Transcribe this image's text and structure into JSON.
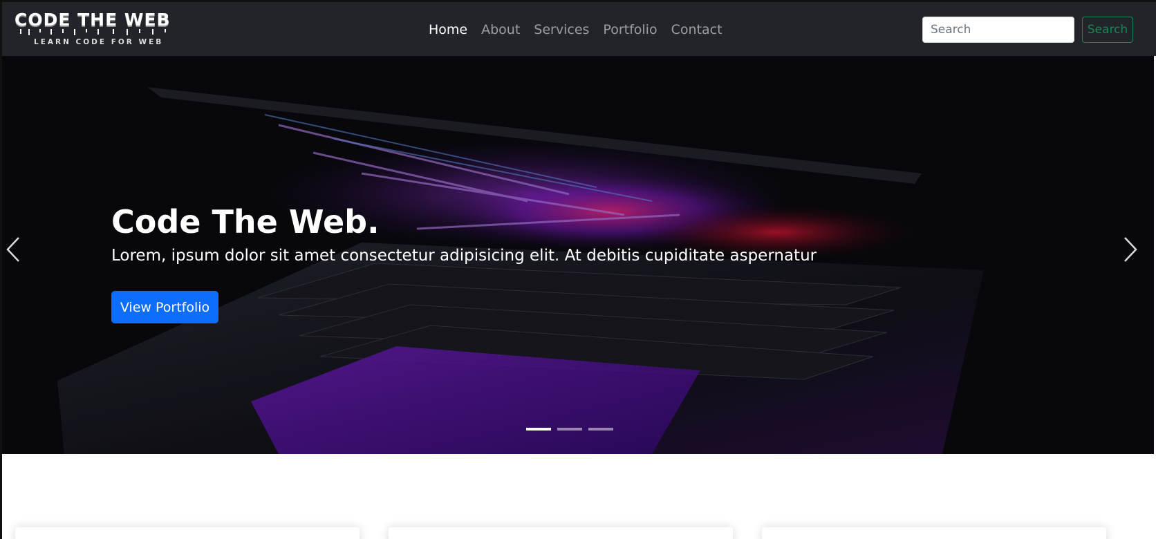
{
  "brand": {
    "title": "CODE THE WEB",
    "subtitle": "LEARN CODE FOR WEB"
  },
  "nav": {
    "links": [
      "Home",
      "About",
      "Services",
      "Portfolio",
      "Contact"
    ],
    "active": "Home"
  },
  "search": {
    "placeholder": "Search",
    "button_label": "Search"
  },
  "hero": {
    "title": "Code The Web.",
    "text": "Lorem, ipsum dolor sit amet consectetur adipisicing elit. At debitis cupiditate aspernatur",
    "button_label": "View Portfolio",
    "slide_count": 3,
    "active_slide": 1
  },
  "colors": {
    "navbar": "#212529",
    "primary": "#0d6efd",
    "success": "#198754"
  }
}
